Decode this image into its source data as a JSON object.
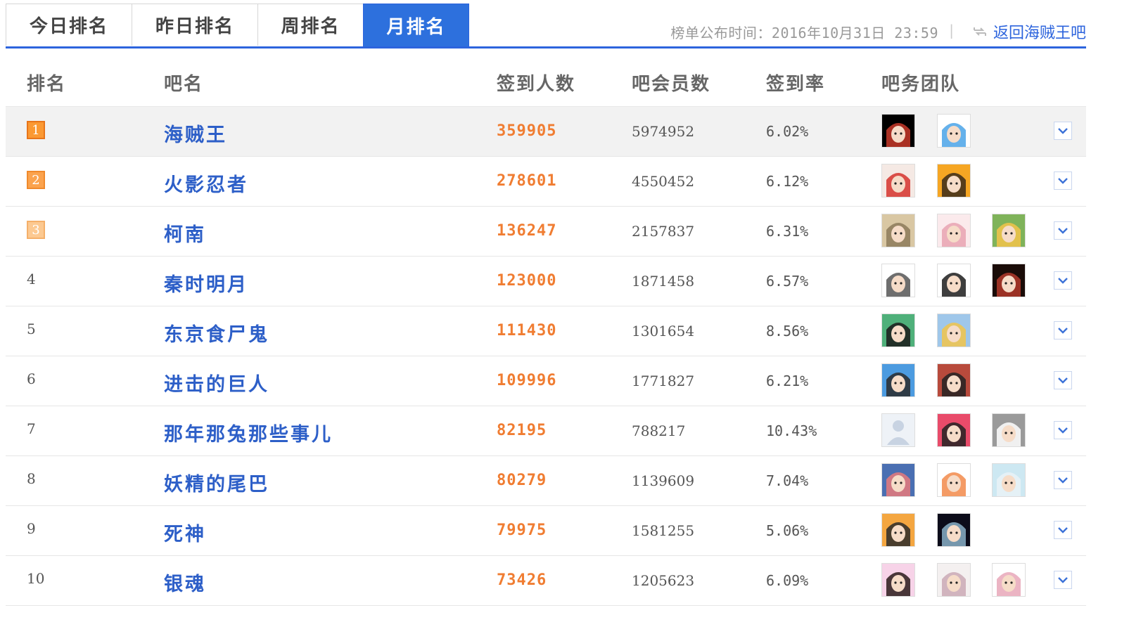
{
  "tabs": [
    {
      "label": "今日排名",
      "active": false
    },
    {
      "label": "昨日排名",
      "active": false
    },
    {
      "label": "周排名",
      "active": false
    },
    {
      "label": "月排名",
      "active": true
    }
  ],
  "publish": {
    "text": "榜单公布时间：2016年10月31日  23:59",
    "separator": "|",
    "back_link": "返回海贼王吧",
    "back_icon": "refresh-arrows-icon"
  },
  "table": {
    "headers": {
      "rank": "排名",
      "name": "吧名",
      "sign": "签到人数",
      "members": "吧会员数",
      "rate": "签到率",
      "team": "吧务团队"
    },
    "rows": [
      {
        "rank": "1",
        "name": "海贼王",
        "sign": "359905",
        "members": "5974952",
        "rate": "6.02%",
        "avatars": [
          {
            "icon": "luffy-avatar",
            "colors": [
              "#000000",
              "#c83a2a"
            ]
          },
          {
            "icon": "skull-flag-avatar",
            "colors": [
              "#ffffff",
              "#4aa3e8"
            ]
          }
        ]
      },
      {
        "rank": "2",
        "name": "火影忍者",
        "sign": "278601",
        "members": "4550452",
        "rate": "6.12%",
        "avatars": [
          {
            "icon": "red-hair-avatar",
            "colors": [
              "#f5e9e4",
              "#d5332d"
            ]
          },
          {
            "icon": "naruto-avatar",
            "colors": [
              "#f6a623",
              "#3a2a1a"
            ]
          }
        ]
      },
      {
        "rank": "3",
        "name": "柯南",
        "sign": "136247",
        "members": "2157837",
        "rate": "6.31%",
        "avatars": [
          {
            "icon": "old-paper-avatar",
            "colors": [
              "#d9c7a3",
              "#8c7a5a"
            ]
          },
          {
            "icon": "pink-girl-avatar",
            "colors": [
              "#fbeaec",
              "#e7a3b2"
            ]
          },
          {
            "icon": "blonde-girl-avatar",
            "colors": [
              "#7fb35a",
              "#f3c34a"
            ]
          }
        ]
      },
      {
        "rank": "4",
        "name": "秦时明月",
        "sign": "123000",
        "members": "1871458",
        "rate": "6.57%",
        "avatars": [
          {
            "icon": "dragon-seal-avatar",
            "colors": [
              "#ffffff",
              "#555555"
            ]
          },
          {
            "icon": "black-hair-avatar",
            "colors": [
              "#ffffff",
              "#1c1c1c"
            ]
          },
          {
            "icon": "dark-woman-avatar",
            "colors": [
              "#1a0c08",
              "#b33a2a"
            ]
          }
        ]
      },
      {
        "rank": "5",
        "name": "东京食尸鬼",
        "sign": "111430",
        "members": "1301654",
        "rate": "8.56%",
        "avatars": [
          {
            "icon": "boy-glasses-avatar",
            "colors": [
              "#4fb07a",
              "#1a1a1a"
            ]
          },
          {
            "icon": "blonde-boy-avatar",
            "colors": [
              "#9fc7ea",
              "#f2c44a"
            ]
          }
        ]
      },
      {
        "rank": "6",
        "name": "进击的巨人",
        "sign": "109996",
        "members": "1771827",
        "rate": "6.21%",
        "avatars": [
          {
            "icon": "anime-glasses-avatar",
            "colors": [
              "#4c9be0",
              "#2a2a2a"
            ]
          },
          {
            "icon": "dark-hair-avatar",
            "colors": [
              "#b84a3c",
              "#222222"
            ]
          }
        ]
      },
      {
        "rank": "7",
        "name": "那年那兔那些事儿",
        "sign": "82195",
        "members": "788217",
        "rate": "10.43%",
        "avatars": [
          {
            "icon": "default-user-avatar",
            "colors": [
              "#eef2f7",
              "#c8d3e2"
            ]
          },
          {
            "icon": "glasses-kid-avatar",
            "colors": [
              "#e94b6a",
              "#222222"
            ]
          },
          {
            "icon": "rabbit-avatar",
            "colors": [
              "#9a9a9a",
              "#ffffff"
            ]
          }
        ]
      },
      {
        "rank": "8",
        "name": "妖精的尾巴",
        "sign": "80279",
        "members": "1139609",
        "rate": "7.04%",
        "avatars": [
          {
            "icon": "pink-hair-boy-avatar",
            "colors": [
              "#4a6fb2",
              "#e77a7a"
            ]
          },
          {
            "icon": "sketch-boy-avatar",
            "colors": [
              "#ffffff",
              "#f28a4a"
            ]
          },
          {
            "icon": "white-hair-avatar",
            "colors": [
              "#cde8f2",
              "#e9f2f7"
            ]
          }
        ]
      },
      {
        "rank": "9",
        "name": "死神",
        "sign": "79975",
        "members": "1581255",
        "rate": "5.06%",
        "avatars": [
          {
            "icon": "orange-face-avatar",
            "colors": [
              "#f4a640",
              "#2a2a2a"
            ]
          },
          {
            "icon": "dark-figure-avatar",
            "colors": [
              "#0c0c1a",
              "#8ab0c8"
            ]
          }
        ]
      },
      {
        "rank": "10",
        "name": "银魂",
        "sign": "73426",
        "members": "1205623",
        "rate": "6.09%",
        "avatars": [
          {
            "icon": "pink-frame-girl-avatar",
            "colors": [
              "#f7d3e8",
              "#2a1a1a"
            ]
          },
          {
            "icon": "long-hair-avatar",
            "colors": [
              "#f4f0f0",
              "#caa9b5"
            ]
          },
          {
            "icon": "sketch-girl-avatar",
            "colors": [
              "#ffffff",
              "#e7a7b8"
            ]
          }
        ]
      }
    ]
  },
  "colors": {
    "accent": "#2d64dd",
    "link": "#2d5fc8",
    "sign_count": "#f07d32",
    "top_row_bg": "#f2f2f2"
  },
  "expand_icon": "chevron-down-icon"
}
